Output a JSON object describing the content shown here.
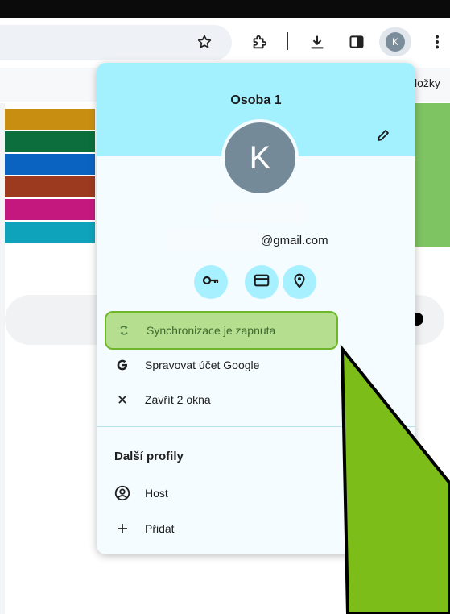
{
  "toolbar": {
    "icons": [
      "star-icon",
      "extensions-icon",
      "download-icon",
      "side-panel-icon",
      "more-icon"
    ],
    "avatar_initial": "K"
  },
  "bookmarks_bar": {
    "visible_text": "ložky"
  },
  "stripes": [
    "#c88e12",
    "#0b6e3c",
    "#0a63c0",
    "#9b3a1f",
    "#c4187e",
    "#0ea3bb"
  ],
  "profile_menu": {
    "profile_name": "Osoba 1",
    "avatar_initial": "K",
    "email_suffix": "@gmail.com",
    "quick_actions": [
      "key-icon",
      "credit-card-icon",
      "location-icon"
    ],
    "items": [
      {
        "label": "Synchronizace je zapnuta",
        "icon": "sync-icon"
      },
      {
        "label": "Spravovat účet Google",
        "icon": "google-g-icon"
      },
      {
        "label": "Zavřít 2 okna",
        "icon": "close-icon"
      }
    ],
    "other_profiles_title": "Další profily",
    "other_profiles": [
      {
        "label": "Host",
        "icon": "guest-icon"
      },
      {
        "label": "Přidat",
        "icon": "plus-icon"
      }
    ]
  },
  "colors": {
    "header": "#a3f1ff",
    "highlight": "#b5de8f",
    "highlight_border": "#6fb62a",
    "arrow": "#7cbd1a"
  }
}
